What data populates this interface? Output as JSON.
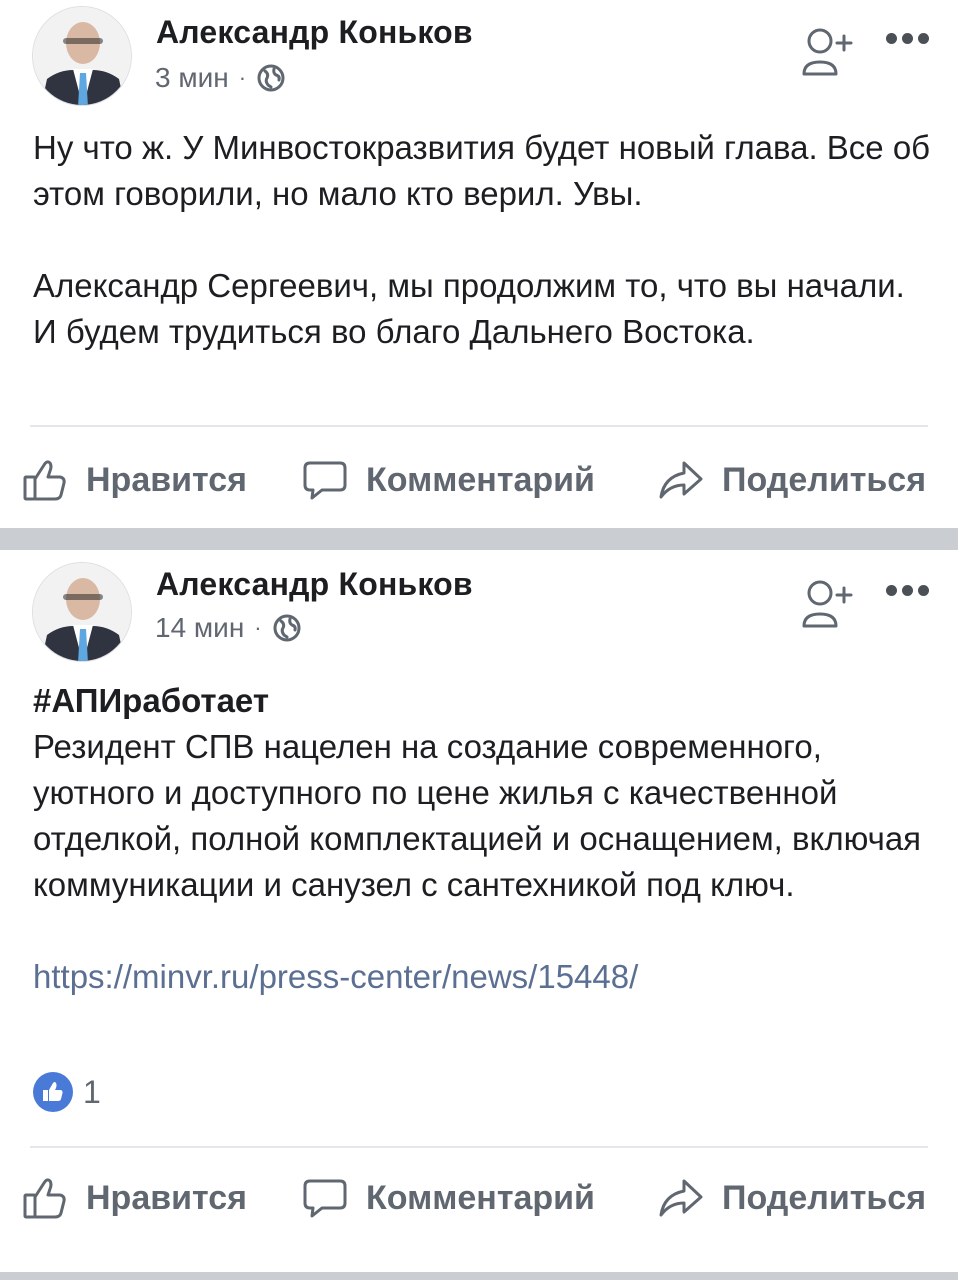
{
  "posts": [
    {
      "author": "Александр Коньков",
      "time": "3 мин",
      "separator": "·",
      "paragraphs": [
        "Ну что ж. У Минвостокразвития будет новый глава. Все об этом говорили, но мало кто верил. Увы.",
        "Александр Сергеевич, мы продолжим то, что вы начали. И будем трудиться во благо Дальнего Востока."
      ],
      "actions": {
        "like": "Нравится",
        "comment": "Комментарий",
        "share": "Поделиться"
      }
    },
    {
      "author": "Александр Коньков",
      "time": "14 мин",
      "separator": "·",
      "hashtag": "#АПИработает",
      "text": "Резидент СПВ нацелен на создание современного, уютного и доступного по цене жилья с качественной отделкой, полной комплектацией и оснащением, включая коммуникации и санузел с сантехникой под ключ.",
      "link": "https://minvr.ru/press-center/news/15448/",
      "reaction_count": "1",
      "actions": {
        "like": "Нравится",
        "comment": "Комментарий",
        "share": "Поделиться"
      }
    }
  ],
  "icons": {
    "like": "thumbs-up-icon",
    "comment": "comment-bubble-icon",
    "share": "share-arrow-icon",
    "follow": "add-friend-icon",
    "more": "more-dots-icon",
    "privacy": "globe-icon"
  },
  "colors": {
    "text": "#1c1e21",
    "secondary": "#606770",
    "link": "#5b6f92",
    "like_badge": "#4a7ad8",
    "separator": "#cacdd2"
  }
}
